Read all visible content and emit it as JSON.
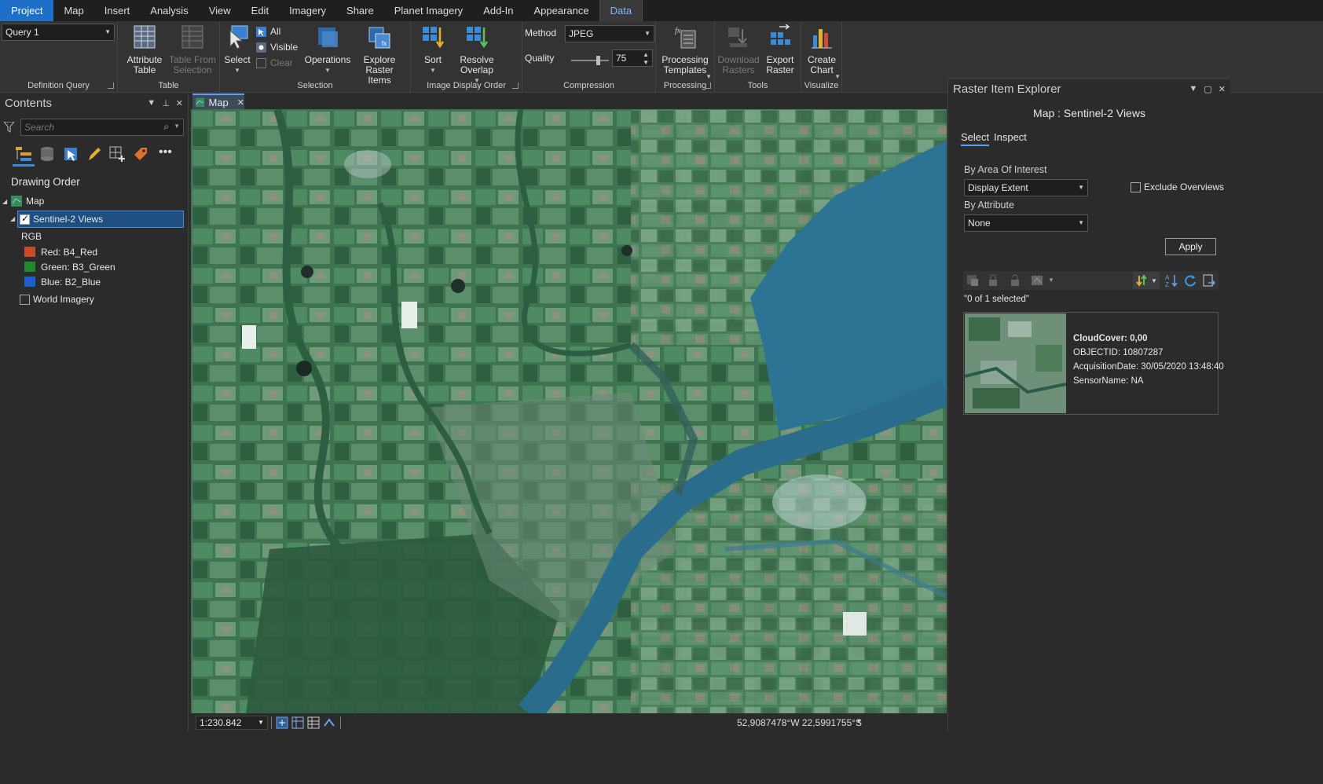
{
  "menu": {
    "tabs": [
      "Project",
      "Map",
      "Insert",
      "Analysis",
      "View",
      "Edit",
      "Imagery",
      "Share",
      "Planet Imagery",
      "Add-In",
      "Appearance",
      "Data"
    ]
  },
  "ribbon": {
    "definition_query": {
      "value": "Query 1",
      "group_label": "Definition Query"
    },
    "table": {
      "attribute_table": "Attribute Table",
      "table_from_selection": "Table From Selection",
      "group_label": "Table"
    },
    "selection": {
      "select": "Select",
      "all": "All",
      "visible": "Visible",
      "clear": "Clear",
      "operations": "Operations",
      "explore": "Explore Raster Items",
      "group_label": "Selection"
    },
    "image_display_order": {
      "sort": "Sort",
      "resolve": "Resolve Overlap",
      "group_label": "Image Display Order"
    },
    "compression": {
      "method_label": "Method",
      "method_value": "JPEG",
      "quality_label": "Quality",
      "quality_value": "75",
      "group_label": "Compression"
    },
    "processing": {
      "templates": "Processing Templates",
      "group_label": "Processing"
    },
    "tools": {
      "download": "Download Rasters",
      "export": "Export Raster",
      "group_label": "Tools"
    },
    "visualize": {
      "create_chart": "Create Chart",
      "group_label": "Visualize"
    }
  },
  "contents": {
    "title": "Contents",
    "search_placeholder": "Search",
    "drawing_order": "Drawing Order",
    "map": "Map",
    "layer": "Sentinel-2 Views",
    "rgb": "RGB",
    "bands": [
      {
        "label": "Red:   B4_Red",
        "color": "#c84a2a"
      },
      {
        "label": "Green: B3_Green",
        "color": "#1f8a2e"
      },
      {
        "label": "Blue:  B2_Blue",
        "color": "#1e5fd0"
      }
    ],
    "world_imagery": "World Imagery"
  },
  "map_tab": {
    "label": "Map"
  },
  "status": {
    "scale": "1:230.842",
    "coords": "52,9087478°W 22,5991755°S"
  },
  "rie": {
    "title": "Raster Item Explorer",
    "heading": "Map : Sentinel-2 Views",
    "tab_select": "Select",
    "tab_inspect": "Inspect",
    "by_aoi": "By Area Of Interest",
    "aoi_value": "Display Extent",
    "exclude_overviews": "Exclude Overviews",
    "by_attribute": "By Attribute",
    "attr_value": "None",
    "apply": "Apply",
    "selected_count": "\"0 of 1 selected\"",
    "item": {
      "cloud": "CloudCover: 0,00",
      "objectid": "OBJECTID: 10807287",
      "date": "AcquisitionDate: 30/05/2020 13:48:40",
      "sensor": "SensorName: NA"
    }
  },
  "colors": {
    "accent": "#1e6fc8",
    "water": "#2d7494",
    "vegetation": "#3c6e4f"
  }
}
